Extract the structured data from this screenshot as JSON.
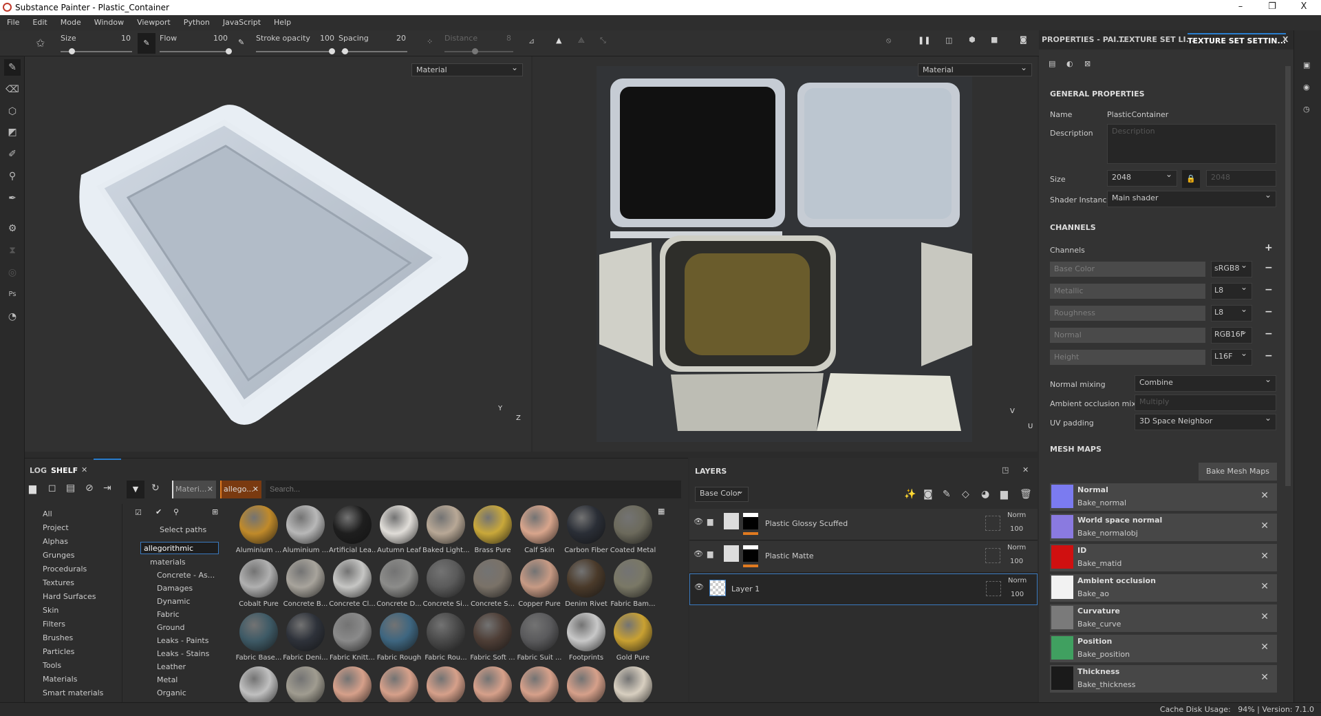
{
  "window": {
    "title": "Substance Painter - Plastic_Container",
    "minimize": "–",
    "maximize": "❐",
    "close": "X"
  },
  "menu": [
    "File",
    "Edit",
    "Mode",
    "Window",
    "Viewport",
    "Python",
    "JavaScript",
    "Help"
  ],
  "toolbar": {
    "size_label": "Size",
    "size_value": "10",
    "size_fraction": 0.15,
    "flow_label": "Flow",
    "flow_value": "100",
    "flow_fraction": 1.0,
    "stroke_opacity_label": "Stroke opacity",
    "stroke_opacity_value": "100",
    "stroke_opacity_fraction": 1.0,
    "spacing_label": "Spacing",
    "spacing_value": "20",
    "spacing_fraction": 0.05,
    "distance_label": "Distance",
    "distance_value": "8"
  },
  "viewport": {
    "mode_3d": "Material",
    "mode_uv": "Material",
    "axis_y": "Y",
    "axis_z": "Z",
    "axis_v": "V",
    "axis_u": "U"
  },
  "properties": {
    "tabs": [
      "PROPERTIES - PAI...",
      "TEXTURE SET LI...",
      "TEXTURE SET SETTIN..."
    ],
    "tab_close": "X",
    "general_title": "GENERAL PROPERTIES",
    "name_label": "Name",
    "name_value": "PlasticContainer",
    "description_label": "Description",
    "description_placeholder": "Description",
    "size_label": "Size",
    "size_value": "2048",
    "size_locked_value": "2048",
    "shader_label": "Shader Instance",
    "shader_value": "Main shader",
    "channels_title": "CHANNELS",
    "channels_label": "Channels",
    "add": "+",
    "channels": [
      {
        "name": "Base Color",
        "format": "sRGB8"
      },
      {
        "name": "Metallic",
        "format": "L8"
      },
      {
        "name": "Roughness",
        "format": "L8"
      },
      {
        "name": "Normal",
        "format": "RGB16F"
      },
      {
        "name": "Height",
        "format": "L16F"
      }
    ],
    "remove": "−",
    "normal_mixing_label": "Normal mixing",
    "normal_mixing_value": "Combine",
    "ao_mixing_label": "Ambient occlusion mixing",
    "ao_mixing_value": "Multiply",
    "uv_padding_label": "UV padding",
    "uv_padding_value": "3D Space Neighbor",
    "mesh_maps_title": "MESH MAPS",
    "bake_button": "Bake Mesh Maps",
    "mesh_maps": [
      {
        "name": "Normal",
        "source": "Bake_normal",
        "color": "#7b7bf0"
      },
      {
        "name": "World space normal",
        "source": "Bake_normalobj",
        "color": "#8a7ae0"
      },
      {
        "name": "ID",
        "source": "Bake_matid",
        "color": "#d01010"
      },
      {
        "name": "Ambient occlusion",
        "source": "Bake_ao",
        "color": "#f2f2f2"
      },
      {
        "name": "Curvature",
        "source": "Bake_curve",
        "color": "#7a7a7a"
      },
      {
        "name": "Position",
        "source": "Bake_position",
        "color": "#40a060"
      },
      {
        "name": "Thickness",
        "source": "Bake_thickness",
        "color": "#1a1a1a"
      }
    ],
    "remove_map": "✕"
  },
  "shelf": {
    "tabs": [
      "LOG",
      "SHELF"
    ],
    "tab_close": "✕",
    "filters": [
      "Materi...",
      "allego..."
    ],
    "filter_close": "✕",
    "search_placeholder": "Search...",
    "select_paths": "Select paths",
    "categories": [
      "All",
      "Project",
      "Alphas",
      "Grunges",
      "Procedurals",
      "Textures",
      "Hard Surfaces",
      "Skin",
      "Filters",
      "Brushes",
      "Particles",
      "Tools",
      "Materials",
      "Smart materials"
    ],
    "tree_root": "allegorithmic",
    "tree_child": "materials",
    "tree_items": [
      "Concrete - As...",
      "Damages",
      "Dynamic",
      "Fabric",
      "Ground",
      "Leaks - Paints",
      "Leaks - Stains",
      "Leather",
      "Metal",
      "Organic"
    ],
    "materials": [
      {
        "name": "Aluminium ...",
        "color": "#c08a2a"
      },
      {
        "name": "Aluminium ...",
        "color": "#b8b8b8"
      },
      {
        "name": "Artificial Lea...",
        "color": "#1e1e1e"
      },
      {
        "name": "Autumn Leaf",
        "color": "#e0ddd8"
      },
      {
        "name": "Baked Light...",
        "color": "#b8a896"
      },
      {
        "name": "Brass Pure",
        "color": "#c9a83a"
      },
      {
        "name": "Calf Skin",
        "color": "#d8a58c"
      },
      {
        "name": "Carbon Fiber",
        "color": "#2a2e36"
      },
      {
        "name": "Coated Metal",
        "color": "#6c6a5c"
      },
      {
        "name": "Cobalt Pure",
        "color": "#b0b0b0"
      },
      {
        "name": "Concrete B...",
        "color": "#a8a49c"
      },
      {
        "name": "Concrete Cl...",
        "color": "#c6c6c4"
      },
      {
        "name": "Concrete D...",
        "color": "#8c8c8a"
      },
      {
        "name": "Concrete Si...",
        "color": "#5a5a5a"
      },
      {
        "name": "Concrete S...",
        "color": "#7a7268"
      },
      {
        "name": "Copper Pure",
        "color": "#c79a84"
      },
      {
        "name": "Denim Rivet",
        "color": "#4a3a2a"
      },
      {
        "name": "Fabric Bam...",
        "color": "#7a7866"
      },
      {
        "name": "Fabric Base...",
        "color": "#3e5a66"
      },
      {
        "name": "Fabric Deni...",
        "color": "#2e323a"
      },
      {
        "name": "Fabric Knitt...",
        "color": "#8a8a8a"
      },
      {
        "name": "Fabric Rough",
        "color": "#3e6680"
      },
      {
        "name": "Fabric Rou...",
        "color": "#4a4a4a"
      },
      {
        "name": "Fabric Soft ...",
        "color": "#4e3e36"
      },
      {
        "name": "Fabric Suit ...",
        "color": "#5a5a5c"
      },
      {
        "name": "Footprints",
        "color": "#c8c8c8"
      },
      {
        "name": "Gold Pure",
        "color": "#c9a132"
      },
      {
        "name": "",
        "color": "#c0c0c0"
      },
      {
        "name": "",
        "color": "#a09c90"
      },
      {
        "name": "",
        "color": "#d6a08a"
      },
      {
        "name": "",
        "color": "#d6a08a"
      },
      {
        "name": "",
        "color": "#d6a08a"
      },
      {
        "name": "",
        "color": "#d6a08a"
      },
      {
        "name": "",
        "color": "#d6a08a"
      },
      {
        "name": "",
        "color": "#d6a08a"
      },
      {
        "name": "",
        "color": "#d8cfc0"
      }
    ]
  },
  "layers": {
    "title": "LAYERS",
    "channel": "Base Color",
    "close": "✕",
    "rows": [
      {
        "name": "Plastic Glossy Scuffed",
        "blend": "Norm",
        "opacity": "100"
      },
      {
        "name": "Plastic Matte",
        "blend": "Norm",
        "opacity": "100"
      },
      {
        "name": "Layer 1",
        "blend": "Norm",
        "opacity": "100"
      }
    ]
  },
  "status": {
    "text": "Cache Disk Usage:   94% | Version: 7.1.0"
  },
  "colors": {
    "accent": "#2a7fd0",
    "orange": "#e07a20"
  }
}
